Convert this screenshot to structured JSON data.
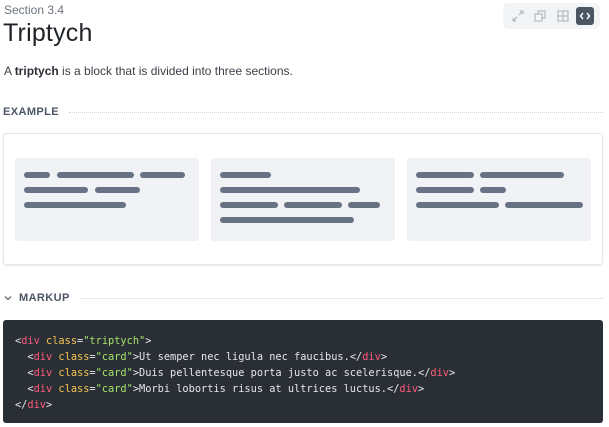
{
  "header": {
    "section_number": "Section 3.4",
    "title": "Triptych",
    "description_prefix": "A ",
    "description_term": "triptych",
    "description_suffix": " is a block that is divided into three sections."
  },
  "toolbar": {
    "buttons": [
      {
        "icon": "expand-icon",
        "active": false
      },
      {
        "icon": "copy-icon",
        "active": false
      },
      {
        "icon": "grid-icon",
        "active": false
      },
      {
        "icon": "code-icon",
        "active": true
      }
    ]
  },
  "example": {
    "label": "EXAMPLE"
  },
  "markup": {
    "label": "MARKUP",
    "lines": [
      {
        "indent": "",
        "tag": "div",
        "class": "triptych",
        "text": "",
        "close": false
      },
      {
        "indent": "  ",
        "tag": "div",
        "class": "card",
        "text": "Ut semper nec ligula nec faucibus.",
        "close": true
      },
      {
        "indent": "  ",
        "tag": "div",
        "class": "card",
        "text": "Duis pellentesque porta justo ac scelerisque.",
        "close": true
      },
      {
        "indent": "  ",
        "tag": "div",
        "class": "card",
        "text": "Morbi lobortis risus at ultrices luctus.",
        "close": true
      }
    ],
    "closing_tag": "div"
  },
  "colors": {
    "code_bg": "#2a2e35",
    "tag": "#ff5a7a",
    "attr": "#f5c451",
    "string": "#a6e36a",
    "placeholder_bar": "#677285",
    "card_bg": "#f0f2f6"
  }
}
